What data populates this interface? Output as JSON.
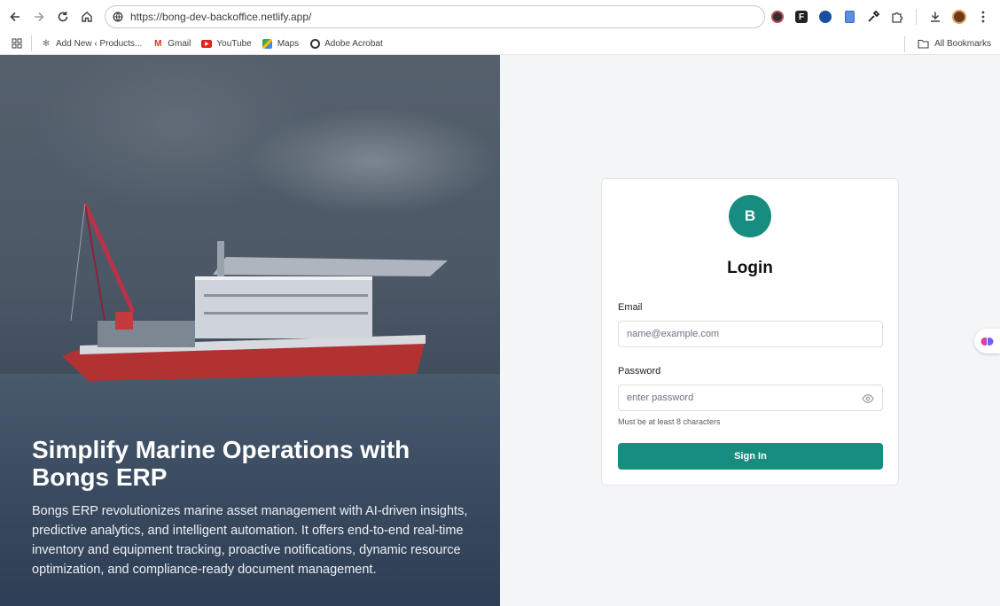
{
  "browser": {
    "url": "https://bong-dev-backoffice.netlify.app/",
    "bookmarks": [
      {
        "label": "Add New ‹ Products...",
        "icon": "puzzle-site-icon"
      },
      {
        "label": "Gmail",
        "icon": "gmail-icon"
      },
      {
        "label": "YouTube",
        "icon": "youtube-icon"
      },
      {
        "label": "Maps",
        "icon": "maps-icon"
      },
      {
        "label": "Adobe Acrobat",
        "icon": "acrobat-icon"
      }
    ],
    "all_bookmarks": "All Bookmarks"
  },
  "hero": {
    "title": "Simplify Marine Operations with Bongs ERP",
    "description": "Bongs ERP revolutionizes marine asset management with AI-driven insights, predictive analytics, and intelligent automation. It offers end-to-end real-time inventory and equipment tracking, proactive notifications, dynamic resource optimization, and compliance-ready document management."
  },
  "login": {
    "avatar_letter": "B",
    "title": "Login",
    "email_label": "Email",
    "email_placeholder": "name@example.com",
    "password_label": "Password",
    "password_placeholder": "enter password",
    "password_hint": "Must be at least 8 characters",
    "submit_label": "Sign In"
  },
  "colors": {
    "accent": "#168d7e",
    "page_bg": "#f4f5f7"
  }
}
